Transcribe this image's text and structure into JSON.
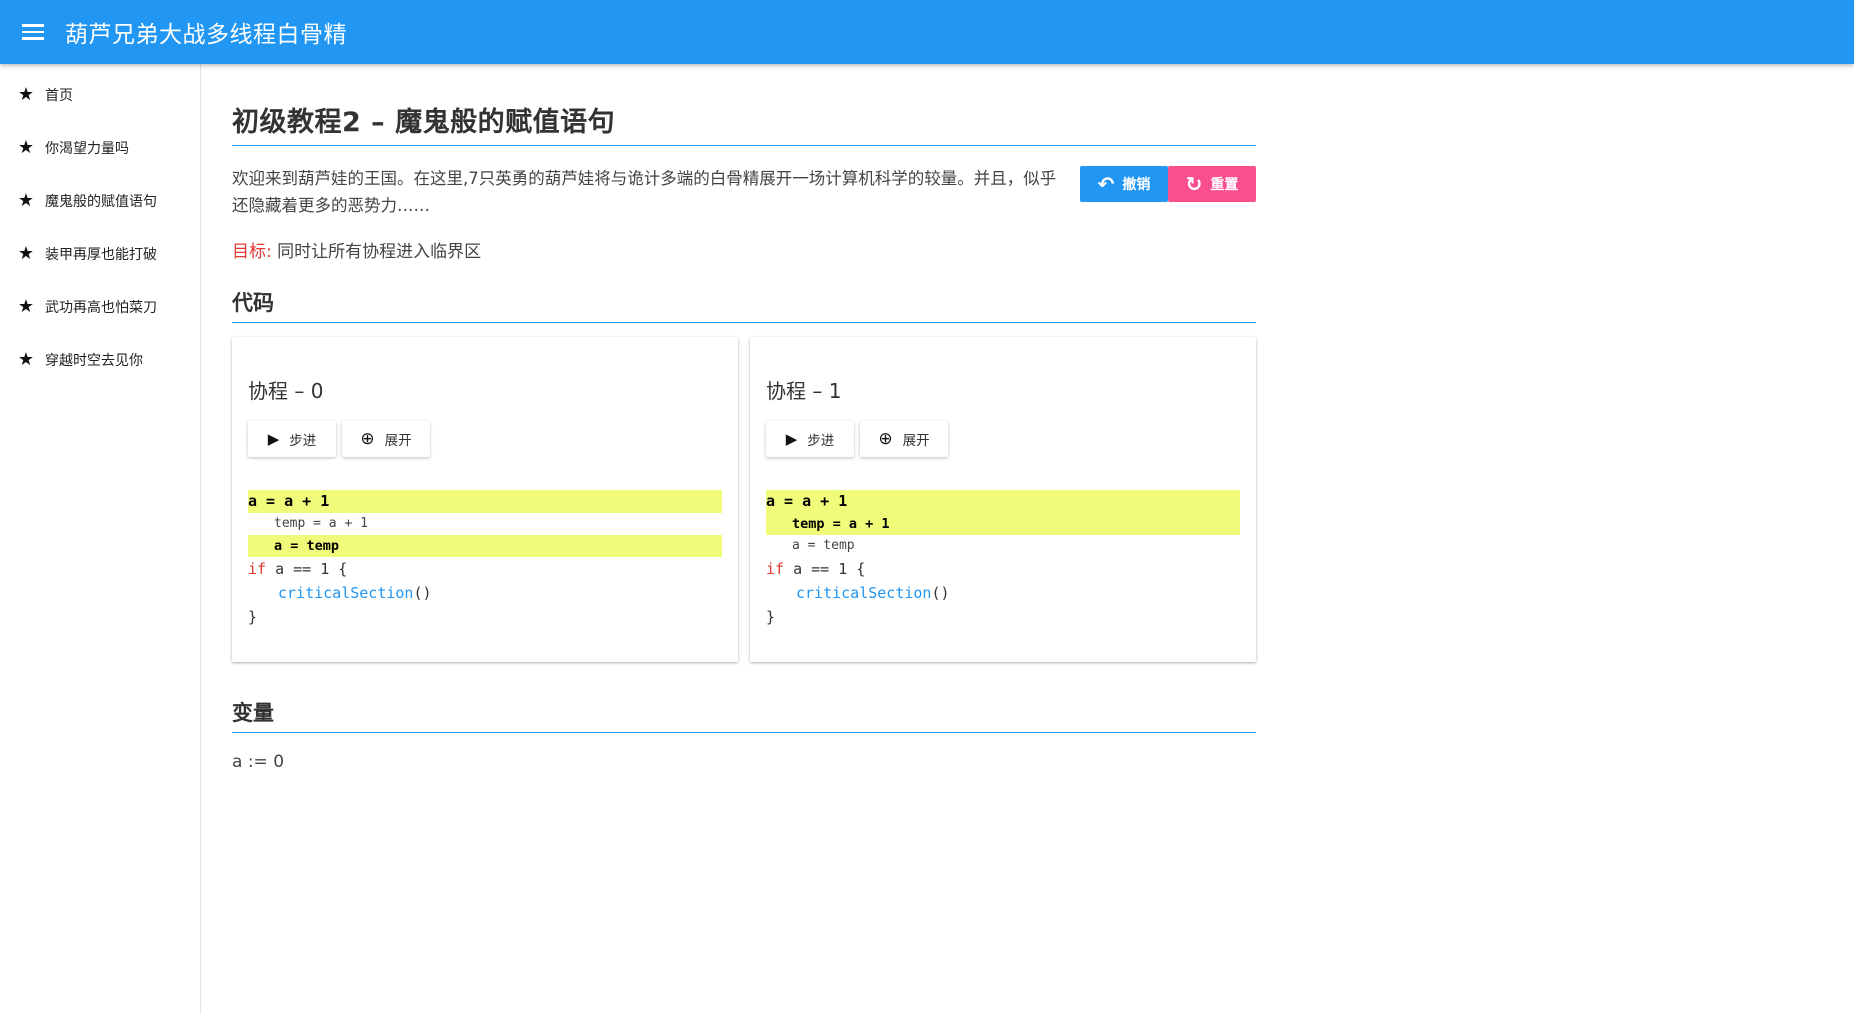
{
  "appbar": {
    "title": "葫芦兄弟大战多线程白骨精"
  },
  "sidebar": {
    "items": [
      {
        "label": "首页"
      },
      {
        "label": "你渴望力量吗"
      },
      {
        "label": "魔鬼般的赋值语句"
      },
      {
        "label": "装甲再厚也能打破"
      },
      {
        "label": "武功再高也怕菜刀"
      },
      {
        "label": "穿越时空去见你"
      }
    ]
  },
  "main": {
    "title": "初级教程2 – 魔鬼般的赋值语句",
    "intro": "欢迎来到葫芦娃的王国。在这里,7只英勇的葫芦娃将与诡计多端的白骨精展开一场计算机科学的较量。并且，似乎还隐藏着更多的恶势力……",
    "undo_label": "撤销",
    "reset_label": "重置",
    "goal_label": "目标:",
    "goal_text": "同时让所有协程进入临界区",
    "code_title": "代码",
    "step_label": "步进",
    "expand_label": "展开",
    "cards": [
      {
        "title": "协程 – 0",
        "code": {
          "line1": "a = a + 1",
          "line2": "temp = a + 1",
          "line3": "a = temp",
          "if_kw": "if",
          "if_rest": " a == 1 {",
          "call_fn": "criticalSection",
          "call_paren": "()",
          "close": "}"
        }
      },
      {
        "title": "协程 – 1",
        "code": {
          "line1": "a = a + 1",
          "line2": "temp = a + 1",
          "line3": "a = temp",
          "if_kw": "if",
          "if_rest": " a == 1 {",
          "call_fn": "criticalSection",
          "call_paren": "()",
          "close": "}"
        }
      }
    ],
    "var_title": "变量",
    "var_text": "a := 0"
  },
  "colors": {
    "primary": "#2196F3",
    "accent": "#F94F8E",
    "highlight": "#F0FC79",
    "keyword": "#e53935"
  },
  "icons": {
    "menu": "hamburger-menu-icon",
    "nav": "star-icon",
    "undo": "undo-arrow-icon",
    "reset": "refresh-icon",
    "step": "play-icon",
    "expand": "zoom-in-icon"
  }
}
